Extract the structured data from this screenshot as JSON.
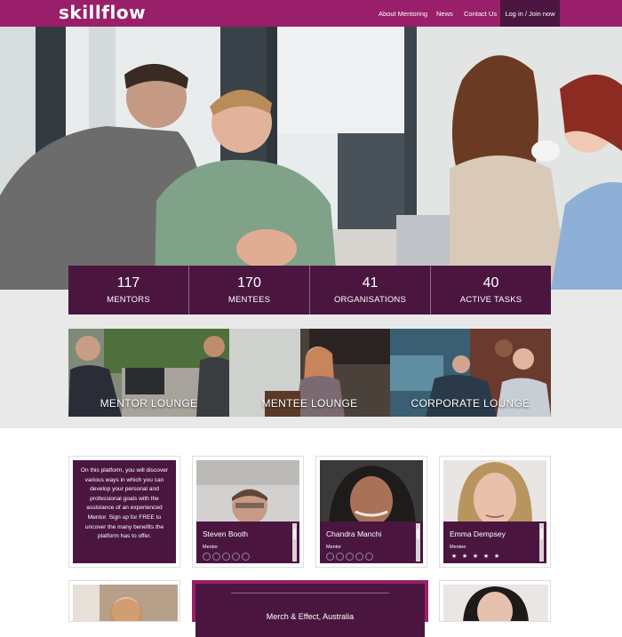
{
  "brand": {
    "name": "skillflow",
    "color": "#9a1f6a",
    "dark": "#4a1640"
  },
  "nav": {
    "items": [
      "About Mentoring",
      "News",
      "Contact Us"
    ],
    "login_label": "Log in / Join now"
  },
  "stats": [
    {
      "value": "117",
      "label": "MENTORS"
    },
    {
      "value": "170",
      "label": "MENTEES"
    },
    {
      "value": "41",
      "label": "ORGANISATIONS"
    },
    {
      "value": "40",
      "label": "ACTIVE TASKS"
    }
  ],
  "lounges": [
    {
      "label": "MENTOR LOUNGE"
    },
    {
      "label": "MENTEE LOUNGE"
    },
    {
      "label": "CORPORATE LOUNGE"
    }
  ],
  "intro": {
    "text": "On this platform, you will discover various ways in which you can develop your personal and professional goals with the assistance of an experienced Mentor. Sign up for FREE to uncover the many benefits the platform has to offer."
  },
  "people": [
    {
      "name": "Steven Booth",
      "role": "Mentor",
      "stars": 0
    },
    {
      "name": "Chandra Manchi",
      "role": "Mentor",
      "stars": 0
    },
    {
      "name": "Emma Dempsey",
      "role": "Mentee",
      "stars": 5
    }
  ],
  "featured": {
    "title": "Merch & Effect, Australia"
  }
}
